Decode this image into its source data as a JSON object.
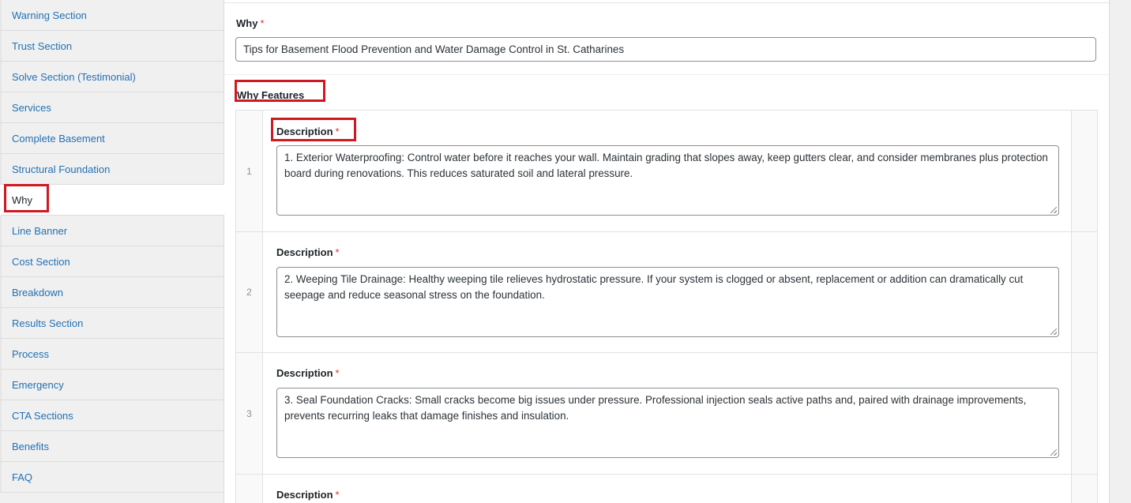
{
  "sidebar": {
    "items": [
      {
        "label": "Warning Section"
      },
      {
        "label": "Trust Section"
      },
      {
        "label": "Solve Section (Testimonial)"
      },
      {
        "label": "Services"
      },
      {
        "label": "Complete Basement"
      },
      {
        "label": "Structural Foundation"
      },
      {
        "label": "Why"
      },
      {
        "label": "Line Banner"
      },
      {
        "label": "Cost Section"
      },
      {
        "label": "Breakdown"
      },
      {
        "label": "Results Section"
      },
      {
        "label": "Process"
      },
      {
        "label": "Emergency"
      },
      {
        "label": "CTA Sections"
      },
      {
        "label": "Benefits"
      },
      {
        "label": "FAQ"
      }
    ],
    "active": "Why"
  },
  "why_field": {
    "label": "Why",
    "required_mark": "*",
    "value": "Tips for Basement Flood Prevention and Water Damage Control in St. Catharines"
  },
  "why_features": {
    "label": "Why Features",
    "rows": [
      {
        "index": "1",
        "label": "Description",
        "required_mark": "*",
        "value": "1. Exterior Waterproofing: Control water before it reaches your wall. Maintain grading that slopes away, keep gutters clear, and consider membranes plus protection board during renovations. This reduces saturated soil and lateral pressure."
      },
      {
        "index": "2",
        "label": "Description",
        "required_mark": "*",
        "value": "2. Weeping Tile Drainage: Healthy weeping tile relieves hydrostatic pressure. If your system is clogged or absent, replacement or addition can dramatically cut seepage and reduce seasonal stress on the foundation."
      },
      {
        "index": "3",
        "label": "Description",
        "required_mark": "*",
        "value": "3. Seal Foundation Cracks: Small cracks become big issues under pressure. Professional injection seals active paths and, paired with drainage improvements, prevents recurring leaks that damage finishes and insulation."
      },
      {
        "index": "",
        "label": "Description",
        "required_mark": "*",
        "value": ""
      }
    ]
  },
  "colors": {
    "link": "#2271b1",
    "required": "#d63638",
    "highlight": "#d01820"
  }
}
